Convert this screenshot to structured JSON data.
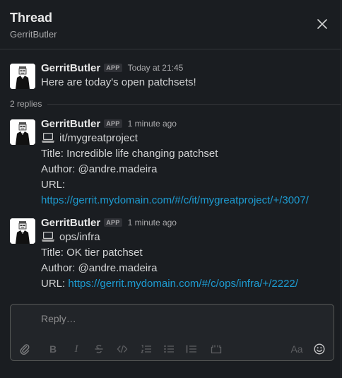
{
  "header": {
    "title": "Thread",
    "subtitle": "GerritButler"
  },
  "parent_message": {
    "author": "GerritButler",
    "badge": "APP",
    "time": "Today at 21:45",
    "text": "Here are today's open patchsets!"
  },
  "replies_label": "2 replies",
  "replies": [
    {
      "author": "GerritButler",
      "badge": "APP",
      "time": "1 minute ago",
      "project_emoji": "laptop-icon",
      "project": "it/mygreatproject",
      "title": "Title: Incredible life changing patchset",
      "author_line": "Author: @andre.madeira",
      "url_label": "URL:",
      "url": "https://gerrit.mydomain.com/#/c/it/mygreatproject/+/3007/"
    },
    {
      "author": "GerritButler",
      "badge": "APP",
      "time": "1 minute ago",
      "project_emoji": "laptop-icon",
      "project": "ops/infra",
      "title": "Title: OK tier patchset",
      "author_line": "Author: @andre.madeira",
      "url_label": "URL:",
      "url": "https://gerrit.mydomain.com/#/c/ops/infra/+/2222/"
    }
  ],
  "composer": {
    "placeholder": "Reply…",
    "text_style_label": "Aa"
  },
  "colors": {
    "background": "#1a1d21",
    "link": "#1d9bd1",
    "text": "#d1d2d3"
  }
}
